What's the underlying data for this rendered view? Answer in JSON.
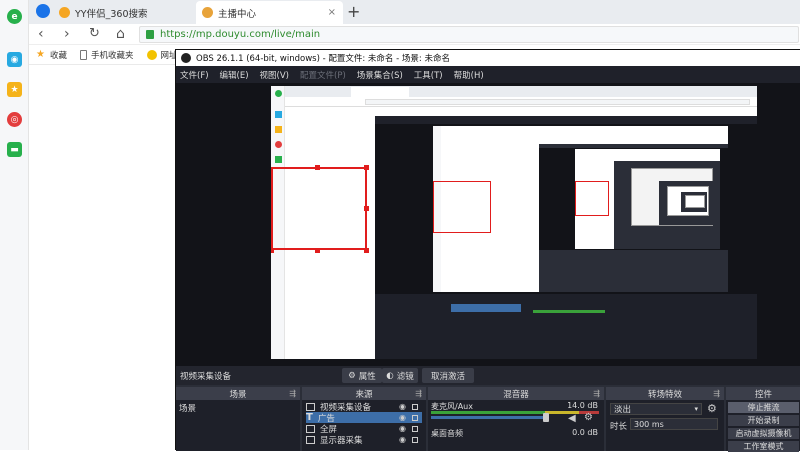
{
  "browser": {
    "tabs": [
      {
        "title": "YY伴侣_360搜索",
        "favicon_color": "#f5a623"
      },
      {
        "title": "主播中心",
        "favicon_color": "#e8a33a"
      }
    ],
    "new_tab_label": "+",
    "close_label": "×",
    "address": {
      "scheme": "https://",
      "rest": "mp.douyu.com/live/main"
    },
    "bookmarks": [
      {
        "label": "收藏",
        "icon": "star-icon"
      },
      {
        "label": "手机收藏夹",
        "icon": "phone-icon"
      },
      {
        "label": "网址大全",
        "icon": "web-icon"
      }
    ],
    "nav": {
      "back": "‹",
      "forward": "›",
      "reload": "↻",
      "home": "⌂"
    },
    "side_icons": [
      "app-icon",
      "star-icon",
      "weibo-icon",
      "mail-icon"
    ]
  },
  "obs": {
    "title": "OBS 26.1.1 (64-bit, windows) - 配置文件: 未命名 - 场景: 未命名",
    "menu": [
      "文件(F)",
      "编辑(E)",
      "视图(V)",
      "配置文件(P)",
      "场景集合(S)",
      "工具(T)",
      "帮助(H)"
    ],
    "selected_source_label": "视频采集设备",
    "properties_button": "属性",
    "filters_button": "滤镜",
    "deactivate_button": "取消激活",
    "docks": {
      "scenes": {
        "header": "场景",
        "items": [
          "场景"
        ]
      },
      "sources": {
        "header": "来源",
        "items": [
          "视频采集设备",
          "广告",
          "全屏",
          "显示器采集"
        ]
      },
      "mixer": {
        "header": "混音器",
        "mic_label": "麦克风/Aux",
        "mic_db": "14.0 dB",
        "desktop_label": "桌面音频",
        "desktop_db": "0.0 dB"
      },
      "transitions": {
        "header": "转场特效",
        "type": "淡出",
        "duration_label": "时长",
        "duration_value": "300 ms"
      },
      "controls": {
        "header": "控件",
        "buttons": [
          "停止推流",
          "开始录制",
          "启动虚拟摄像机",
          "工作室模式"
        ]
      }
    }
  },
  "colors": {
    "obs_bg": "#2b2e38",
    "obs_dock": "#1e2029",
    "source_selected": "#3d6ea8",
    "red_outline": "#e11d1d",
    "url_green": "#2e8b2e"
  }
}
